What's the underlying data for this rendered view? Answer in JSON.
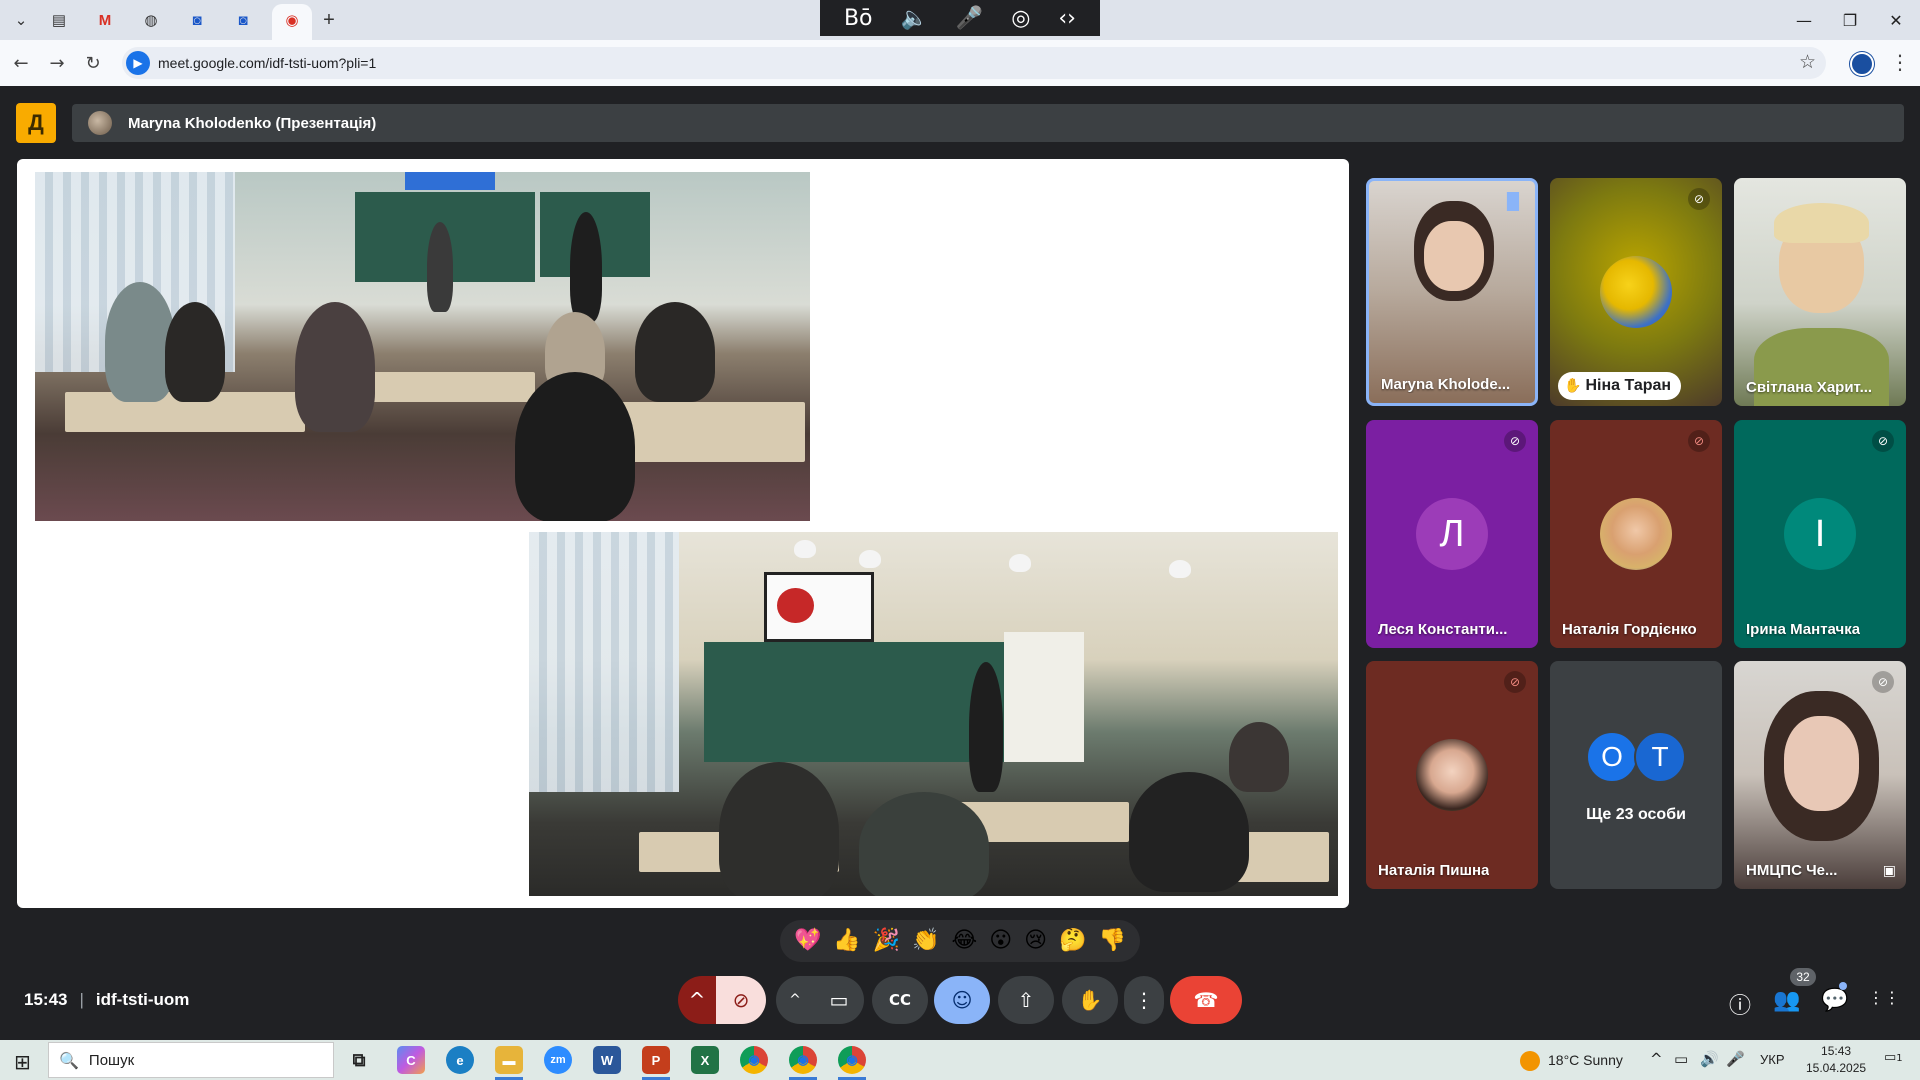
{
  "browser": {
    "url": "meet.google.com/idf-tsti-uom?pli=1",
    "tabs": [
      {
        "icon": "tab-list-icon",
        "glyph": "⌄"
      },
      {
        "icon": "drive-icon",
        "glyph": "▤"
      },
      {
        "icon": "gmail-icon",
        "glyph": "M"
      },
      {
        "icon": "site-icon",
        "glyph": "◍"
      },
      {
        "icon": "zoom-icon",
        "glyph": "◙"
      },
      {
        "icon": "zoom-icon",
        "glyph": "◙"
      },
      {
        "icon": "meet-record-icon",
        "glyph": "◉"
      },
      {
        "icon": "new-tab-icon",
        "glyph": "+"
      }
    ],
    "window_controls": {
      "minimize": "—",
      "restore": "❐",
      "close": "✕"
    },
    "nav": {
      "back": "←",
      "forward": "→",
      "reload": "↻"
    },
    "star_glyph": "☆",
    "menu_glyph": "⋮"
  },
  "extension_bar": {
    "items": [
      "Bō",
      "🔈",
      "🎤",
      "◎",
      "‹›"
    ]
  },
  "meet": {
    "presenter_label": "Maryna Kholodenko (Презентація)",
    "logo_glyph": "Д",
    "meeting_time": "15:43",
    "meeting_separator": "|",
    "meeting_code": "idf-tsti-uom",
    "participants": [
      {
        "name": "Maryna Kholode...",
        "status": "speaking",
        "kind": "video"
      },
      {
        "name": "Ніна Таран",
        "status": "hand-raised",
        "kind": "photo"
      },
      {
        "name": "Світлана Харит...",
        "status": "active",
        "kind": "video"
      },
      {
        "name": "Леся Константи...",
        "status": "muted",
        "kind": "letter",
        "letter": "Л"
      },
      {
        "name": "Наталія Гордієнко",
        "status": "muted",
        "kind": "photo"
      },
      {
        "name": "Ірина Мантачка",
        "status": "muted",
        "kind": "letter",
        "letter": "І"
      },
      {
        "name": "Наталія Пишна",
        "status": "muted",
        "kind": "photo"
      },
      {
        "name": "Ще 23 особи",
        "status": "none",
        "kind": "more",
        "letters": [
          "О",
          "Т"
        ]
      },
      {
        "name": "НМЦПС Че...",
        "status": "muted",
        "kind": "video"
      }
    ],
    "reactions": [
      "💖",
      "👍",
      "🎉",
      "👏",
      "😂",
      "😮",
      "😢",
      "🤔",
      "👎"
    ],
    "controls": {
      "mic_caret": "^",
      "mic": "🎙",
      "cam_caret": "^",
      "camera": "📹",
      "captions": "CC",
      "emoji": "☺",
      "present": "⇧",
      "hand": "✋",
      "more": "⋮",
      "leave": "☎"
    },
    "right_controls": {
      "info": "ⓘ",
      "people": "👥",
      "people_count": "32",
      "chat": "💬",
      "activities": "⋮⋮"
    }
  },
  "taskbar": {
    "start_glyph": "⊞",
    "search_placeholder": "Пошук",
    "search_glyph": "🔍",
    "apps": [
      {
        "name": "task-view",
        "label": "⧉",
        "color": "#dfe9e6"
      },
      {
        "name": "copilot",
        "label": "C",
        "color": "#6a5acd"
      },
      {
        "name": "edge",
        "label": "e",
        "color": "#1b7fc4"
      },
      {
        "name": "explorer",
        "label": "▬",
        "color": "#e7b43a"
      },
      {
        "name": "zoom",
        "label": "zm",
        "color": "#2d8cff"
      },
      {
        "name": "word",
        "label": "W",
        "color": "#2b579a"
      },
      {
        "name": "powerpoint",
        "label": "P",
        "color": "#c43e1c"
      },
      {
        "name": "excel",
        "label": "X",
        "color": "#217346"
      },
      {
        "name": "chrome-1",
        "label": "◉",
        "color": "#db4437"
      },
      {
        "name": "chrome-2",
        "label": "◉",
        "color": "#db4437"
      },
      {
        "name": "chrome-3",
        "label": "◉",
        "color": "#db4437"
      }
    ],
    "weather": "18°C  Sunny",
    "language": "УКР",
    "clock_time": "15:43",
    "clock_date": "15.04.2025",
    "tray_glyphs": [
      "^",
      "▭",
      "🔊",
      "🎤"
    ],
    "notification_count": "1"
  }
}
